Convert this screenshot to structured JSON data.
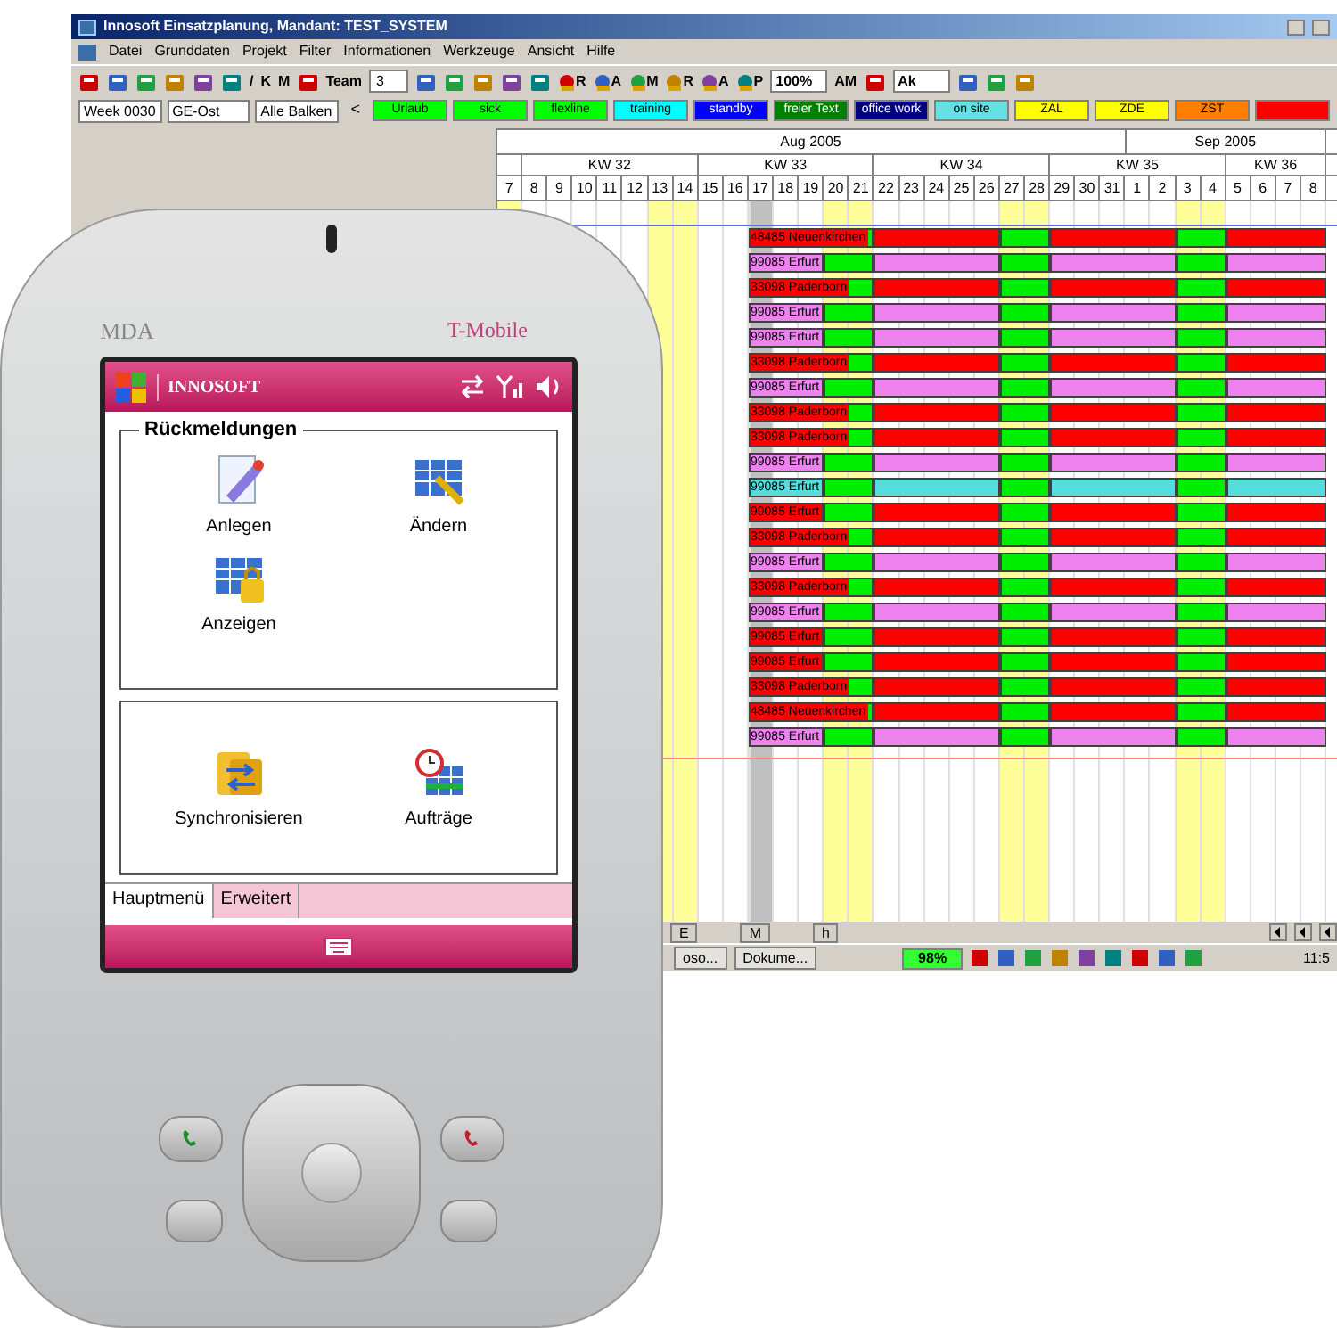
{
  "window": {
    "title": "Innosoft Einsatzplanung, Mandant: TEST_SYSTEM"
  },
  "menu": [
    "Datei",
    "Grunddaten",
    "Projekt",
    "Filter",
    "Informationen",
    "Werkzeuge",
    "Ansicht",
    "Hilfe"
  ],
  "toolbar": [
    {
      "kind": "icon"
    },
    {
      "kind": "icon"
    },
    {
      "kind": "icon"
    },
    {
      "kind": "icon"
    },
    {
      "kind": "icon"
    },
    {
      "kind": "icon"
    },
    {
      "kind": "text",
      "label": "/"
    },
    {
      "kind": "text",
      "label": "K"
    },
    {
      "kind": "text",
      "label": "M"
    },
    {
      "kind": "icon"
    },
    {
      "kind": "text",
      "label": "Team"
    },
    {
      "kind": "spinner",
      "label": "3"
    },
    {
      "kind": "icon"
    },
    {
      "kind": "icon"
    },
    {
      "kind": "icon"
    },
    {
      "kind": "icon"
    },
    {
      "kind": "icon"
    },
    {
      "kind": "icon_letter",
      "label": "R"
    },
    {
      "kind": "icon_letter",
      "label": "A"
    },
    {
      "kind": "icon_letter",
      "label": "M"
    },
    {
      "kind": "icon_letter",
      "label": "R"
    },
    {
      "kind": "icon_letter",
      "label": "A"
    },
    {
      "kind": "icon_letter",
      "label": "P"
    },
    {
      "kind": "dropdown",
      "label": "100%"
    },
    {
      "kind": "text",
      "label": "AM"
    },
    {
      "kind": "icon"
    },
    {
      "kind": "dropdown",
      "label": "Ak"
    },
    {
      "kind": "icon"
    },
    {
      "kind": "icon"
    },
    {
      "kind": "icon"
    }
  ],
  "filters": [
    {
      "value": "Week 0030"
    },
    {
      "value": "GE-Ost"
    },
    {
      "value": "Alle Balken"
    }
  ],
  "legend_nav": "<",
  "legend": [
    {
      "label": "Urlaub",
      "color": "#00ff00"
    },
    {
      "label": "sick",
      "color": "#00ff00"
    },
    {
      "label": "flexline",
      "color": "#00ff00"
    },
    {
      "label": "training",
      "color": "#00ffff"
    },
    {
      "label": "standby",
      "color": "#0000ff"
    },
    {
      "label": "freier Text",
      "color": "#008000"
    },
    {
      "label": "office work",
      "color": "#000080"
    },
    {
      "label": "on site",
      "color": "#66e0e0"
    },
    {
      "label": "ZAL",
      "color": "#ffff00"
    },
    {
      "label": "ZDE",
      "color": "#ffff00"
    },
    {
      "label": "ZST",
      "color": "#ff8000"
    },
    {
      "color": "#ff0000"
    }
  ],
  "months": [
    "Aug 2005",
    "Sep 2005"
  ],
  "weeks": [
    "KW 32",
    "KW 33",
    "KW 34",
    "KW 35",
    "KW 36"
  ],
  "days": [
    {
      "label": "7",
      "weekend": true,
      "today": false
    },
    {
      "label": "8",
      "weekend": false,
      "today": false
    },
    {
      "label": "9",
      "weekend": false,
      "today": false
    },
    {
      "label": "10",
      "weekend": false,
      "today": false
    },
    {
      "label": "11",
      "weekend": false,
      "today": false
    },
    {
      "label": "12",
      "weekend": false,
      "today": false
    },
    {
      "label": "13",
      "weekend": true,
      "today": false
    },
    {
      "label": "14",
      "weekend": true,
      "today": false
    },
    {
      "label": "15",
      "weekend": false,
      "today": false
    },
    {
      "label": "16",
      "weekend": false,
      "today": false
    },
    {
      "label": "17",
      "weekend": false,
      "today": true
    },
    {
      "label": "18",
      "weekend": false,
      "today": false
    },
    {
      "label": "19",
      "weekend": false,
      "today": false
    },
    {
      "label": "20",
      "weekend": true,
      "today": false
    },
    {
      "label": "21",
      "weekend": true,
      "today": false
    },
    {
      "label": "22",
      "weekend": false,
      "today": false
    },
    {
      "label": "23",
      "weekend": false,
      "today": false
    },
    {
      "label": "24",
      "weekend": false,
      "today": false
    },
    {
      "label": "25",
      "weekend": false,
      "today": false
    },
    {
      "label": "26",
      "weekend": false,
      "today": false
    },
    {
      "label": "27",
      "weekend": true,
      "today": false
    },
    {
      "label": "28",
      "weekend": true,
      "today": false
    },
    {
      "label": "29",
      "weekend": false,
      "today": false
    },
    {
      "label": "30",
      "weekend": false,
      "today": false
    },
    {
      "label": "31",
      "weekend": false,
      "today": false
    },
    {
      "label": "1",
      "weekend": false,
      "today": false
    },
    {
      "label": "2",
      "weekend": false,
      "today": false
    },
    {
      "label": "3",
      "weekend": true,
      "today": false
    },
    {
      "label": "4",
      "weekend": true,
      "today": false
    },
    {
      "label": "5",
      "weekend": false,
      "today": false
    },
    {
      "label": "6",
      "weekend": false,
      "today": false
    },
    {
      "label": "7",
      "weekend": false,
      "today": false
    },
    {
      "label": "8",
      "weekend": false,
      "today": false
    }
  ],
  "rows": [
    {
      "label": "48485 Neuenkirchen",
      "color": "#ff0000"
    },
    {
      "label": "99085 Erfurt",
      "color": "#ee82ee"
    },
    {
      "label": "33098 Paderborn",
      "color": "#ff0000"
    },
    {
      "label": "99085 Erfurt",
      "color": "#ee82ee"
    },
    {
      "label": "99085 Erfurt",
      "color": "#ee82ee"
    },
    {
      "label": "33098 Paderborn",
      "color": "#ff0000"
    },
    {
      "label": "99085 Erfurt",
      "color": "#ee82ee"
    },
    {
      "label": "33098 Paderborn",
      "color": "#ff0000"
    },
    {
      "label": "33098 Paderborn",
      "color": "#ff0000"
    },
    {
      "label": "99085 Erfurt",
      "color": "#ee82ee"
    },
    {
      "label": "99085 Erfurt",
      "color": "#55dddd"
    },
    {
      "label": "99085 Erfurt",
      "color": "#ff0000"
    },
    {
      "label": "33098 Paderborn",
      "color": "#ff0000"
    },
    {
      "label": "99085 Erfurt",
      "color": "#ee82ee"
    },
    {
      "label": "33098 Paderborn",
      "color": "#ff0000"
    },
    {
      "label": "99085 Erfurt",
      "color": "#ee82ee"
    },
    {
      "label": "99085 Erfurt",
      "color": "#ff0000"
    },
    {
      "label": "99085 Erfurt",
      "color": "#ff0000"
    },
    {
      "label": "33098 Paderborn",
      "color": "#ff0000"
    },
    {
      "label": "48485 Neuenkirchen",
      "color": "#ff0000"
    },
    {
      "label": "99085 Erfurt",
      "color": "#ee82ee"
    }
  ],
  "bottom_tabs": [
    "E",
    "M",
    "h"
  ],
  "taskbar": {
    "items": [
      "oso...",
      "Dokume..."
    ],
    "battery": "98%",
    "clock": "11:5"
  },
  "phone": {
    "model": "MDA",
    "carrier": "T-Mobile",
    "screen": {
      "title": "INNOSOFT",
      "groups": [
        {
          "title": "Rückmeldungen",
          "items": [
            {
              "label": "Anlegen",
              "kind": "create"
            },
            {
              "label": "Ändern",
              "kind": "edit"
            },
            {
              "label": "Anzeigen",
              "kind": "view"
            }
          ]
        },
        {
          "items": [
            {
              "label": "Synchronisieren",
              "kind": "sync"
            },
            {
              "label": "Aufträge",
              "kind": "orders"
            }
          ]
        }
      ],
      "tabs": [
        {
          "label": "Hauptmenü",
          "selected": true
        },
        {
          "label": "Erweitert",
          "selected": false
        }
      ]
    }
  }
}
